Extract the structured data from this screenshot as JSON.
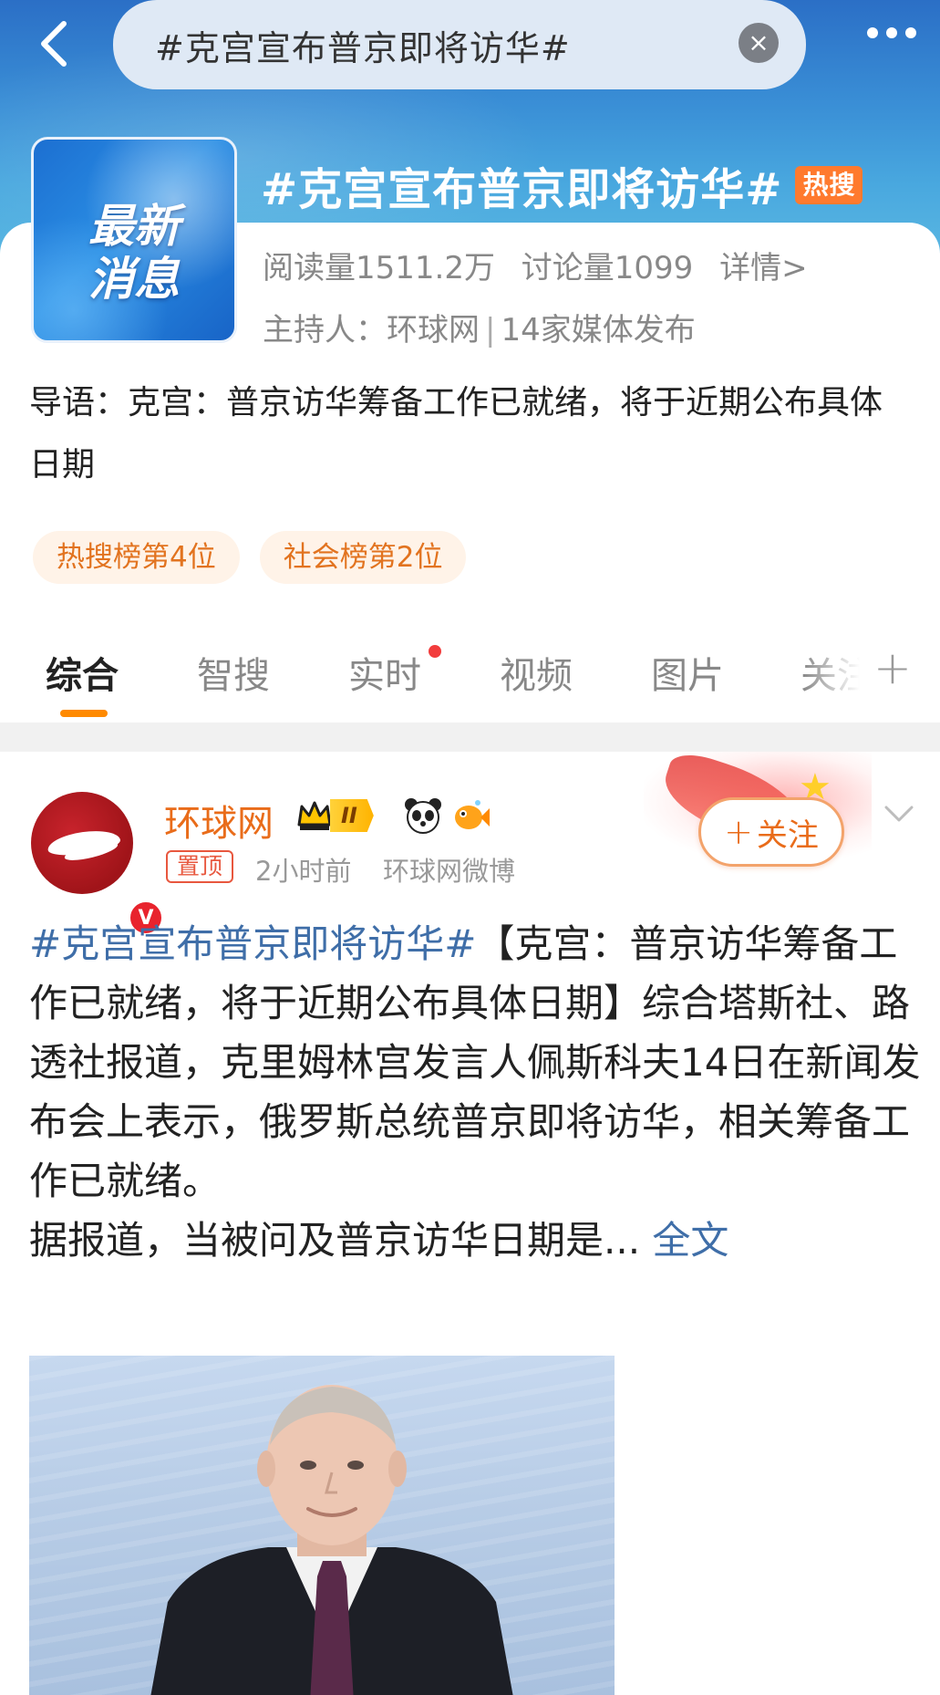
{
  "header": {
    "search_query": "#克宫宣布普京即将访华#",
    "clear_icon": "close-circle-icon",
    "back_icon": "chevron-left-icon",
    "more_icon": "more-dots-icon"
  },
  "topic": {
    "thumbnail_text": [
      "最新",
      "消息"
    ],
    "title": "#克宫宣布普京即将访华#",
    "hot_badge": "热搜",
    "reads": "阅读量1511.2万",
    "discussions": "讨论量1099",
    "details_link": "详情>",
    "host_label": "主持人：环球网",
    "media_count": "14家媒体发布",
    "lead": "导语：克宫：普京访华筹备工作已就绪，将于近期公布具体日期",
    "rank_tags": [
      "热搜榜第4位",
      "社会榜第2位"
    ]
  },
  "tabs": {
    "items": [
      "综合",
      "智搜",
      "实时",
      "视频",
      "图片",
      "关注"
    ],
    "active": "综合",
    "plus": "+"
  },
  "post": {
    "author": "环球网",
    "level_badge": "II",
    "pin_label": "置顶",
    "time": "2小时前",
    "source": "环球网微博",
    "follow_label": "关注",
    "follow_plus": "+",
    "hashtag": "#克宫宣布普京即将访华#",
    "body": "【克宫：普京访华筹备工作已就绪，将于近期公布具体日期】综合塔斯社、路透社报道，克里姆林宫发言人佩斯科夫14日在新闻发布会上表示，俄罗斯总统普京即将访华，相关筹备工作已就绪。",
    "body_2": "据报道，当被问及普京访华日期是...",
    "read_more": "全文"
  },
  "colors": {
    "accent_orange": "#e96c1a",
    "hashtag_blue": "#3f6ea8",
    "hot_badge": "#ff7a2e",
    "tab_underline": "#ff8a00",
    "header_blue": "#3a8fd6"
  }
}
